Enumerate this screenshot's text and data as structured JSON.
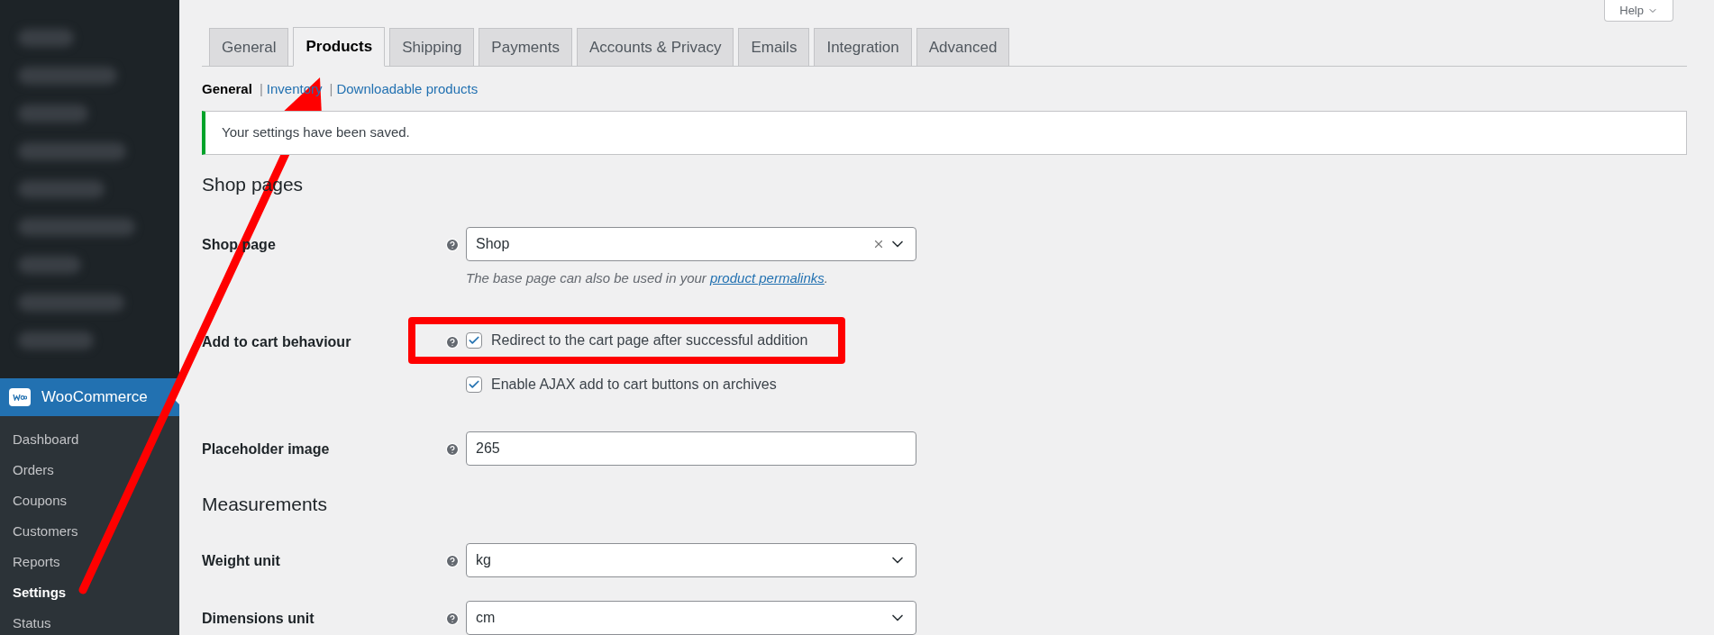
{
  "help_button": {
    "label": "Help"
  },
  "sidebar": {
    "section": {
      "label": "WooCommerce"
    },
    "items": [
      {
        "label": "Dashboard",
        "selected": false
      },
      {
        "label": "Orders",
        "selected": false
      },
      {
        "label": "Coupons",
        "selected": false
      },
      {
        "label": "Customers",
        "selected": false
      },
      {
        "label": "Reports",
        "selected": false
      },
      {
        "label": "Settings",
        "selected": true
      },
      {
        "label": "Status",
        "selected": false
      }
    ]
  },
  "tabs": [
    {
      "label": "General",
      "selected": false
    },
    {
      "label": "Products",
      "selected": true
    },
    {
      "label": "Shipping",
      "selected": false
    },
    {
      "label": "Payments",
      "selected": false
    },
    {
      "label": "Accounts & Privacy",
      "selected": false
    },
    {
      "label": "Emails",
      "selected": false
    },
    {
      "label": "Integration",
      "selected": false
    },
    {
      "label": "Advanced",
      "selected": false
    }
  ],
  "subnav": [
    {
      "label": "General",
      "selected": true
    },
    {
      "separator": "|",
      "label": "Inventory",
      "selected": false
    },
    {
      "separator": "|",
      "label": "Downloadable products",
      "selected": false
    }
  ],
  "notice": "Your settings have been saved.",
  "sections": [
    {
      "heading": "Shop pages",
      "fields": [
        {
          "kind": "select",
          "label": "Shop page",
          "value": "Shop",
          "clearable": true,
          "description": {
            "before": "The base page can also be used in your ",
            "link": "product permalinks",
            "after": "."
          }
        },
        {
          "kind": "checkboxes",
          "label": "Add to cart behaviour",
          "options": [
            {
              "label": "Redirect to the cart page after successful addition",
              "checked": true,
              "highlighted": true
            },
            {
              "label": "Enable AJAX add to cart buttons on archives",
              "checked": true,
              "highlighted": false
            }
          ]
        },
        {
          "kind": "text",
          "label": "Placeholder image",
          "value": "265"
        }
      ]
    },
    {
      "heading": "Measurements",
      "fields": [
        {
          "kind": "select",
          "label": "Weight unit",
          "value": "kg",
          "clearable": false
        },
        {
          "kind": "select",
          "label": "Dimensions unit",
          "value": "cm",
          "clearable": false
        }
      ]
    }
  ],
  "annotation": {
    "arrow": true
  }
}
